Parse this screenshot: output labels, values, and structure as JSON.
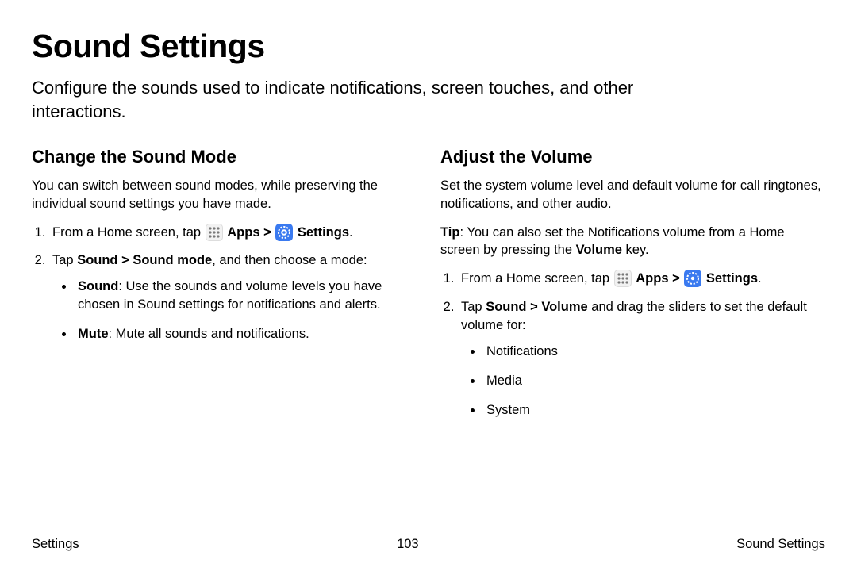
{
  "page": {
    "title": "Sound Settings",
    "intro": "Configure the sounds used to indicate notifications, screen touches, and other interactions."
  },
  "left": {
    "heading": "Change the Sound Mode",
    "intro": "You can switch between sound modes, while preserving the individual sound settings you have made.",
    "step1_prefix": "From a Home screen, tap ",
    "apps_label": "Apps",
    "separator": " > ",
    "settings_label": "Settings",
    "step1_suffix": ".",
    "step2_prefix": "Tap ",
    "step2_bold": "Sound > Sound mode",
    "step2_suffix": ", and then choose a mode:",
    "bullet1_bold": "Sound",
    "bullet1_rest": ": Use the sounds and volume levels you have chosen in Sound settings for notifications and alerts.",
    "bullet2_bold": "Mute",
    "bullet2_rest": ": Mute all sounds and notifications."
  },
  "right": {
    "heading": "Adjust the Volume",
    "intro": "Set the system volume level and default volume for call ringtones, notifications, and other audio.",
    "tip_bold": "Tip",
    "tip_mid": ": You can also set the Notifications volume from a Home screen by pressing the ",
    "tip_bold2": "Volume",
    "tip_end": " key.",
    "step1_prefix": "From a Home screen, tap ",
    "apps_label": "Apps",
    "separator": " > ",
    "settings_label": "Settings",
    "step1_suffix": ".",
    "step2_prefix": "Tap ",
    "step2_bold": "Sound > Volume",
    "step2_suffix": " and drag the sliders to set the default volume for:",
    "bullet1": "Notifications",
    "bullet2": "Media",
    "bullet3": "System"
  },
  "footer": {
    "left": "Settings",
    "center": "103",
    "right": "Sound Settings"
  }
}
